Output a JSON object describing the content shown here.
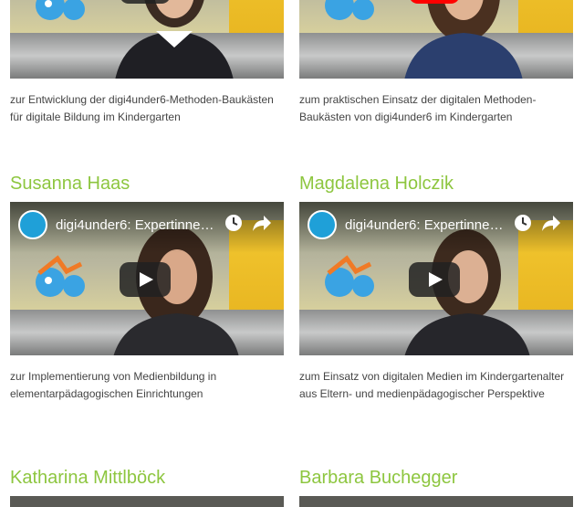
{
  "cards": [
    {
      "desc": "zur Entwicklung der digi4under6-Methoden-Baukästen für digitale Bildung im Kindergarten"
    },
    {
      "desc": "zum praktischen Einsatz der digitalen Methoden-Baukästen von digi4under6 im Kindergarten"
    },
    {
      "name": "Susanna Haas",
      "video_title": "digi4under6: Expertinnen-...",
      "desc": "zur Implementierung von Medienbildung in elementarpädagogischen Einrichtungen"
    },
    {
      "name": "Magdalena Holczik",
      "video_title": "digi4under6: Expertinnen-...",
      "desc": "zum Einsatz von digitalen Medien im Kindergartenalter aus Eltern- und medienpädagogischer Perspektive"
    },
    {
      "name": "Katharina Mittlböck"
    },
    {
      "name": "Barbara Buchegger"
    }
  ],
  "colors": {
    "name_green": "#8dc63f",
    "youtube_red": "#ff0000",
    "channel_blue": "#1fa0d8"
  }
}
